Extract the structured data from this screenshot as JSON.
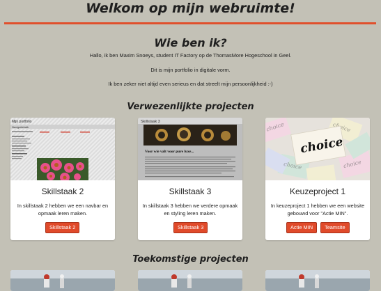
{
  "header": {
    "title": "Welkom op mijn webruimte!"
  },
  "about": {
    "heading": "Wie ben ik?",
    "paragraphs": [
      "Hallo, ik ben Maxim Snoeys, student IT Factory op de ThomasMore Hogeschool in Geel.",
      "Dit is mijn portfolio in digitale vorm.",
      "Ik ben zeker niet altijd even serieus en dat streelt mijn persoonlijkheid :-)"
    ]
  },
  "projects": {
    "heading": "Verwezenlijkte projecten",
    "cards": [
      {
        "title": "Skillstaak 2",
        "text": "In skillstaak 2 hebben we een navbar en opmaak leren maken.",
        "buttons": [
          "Skillstaak 2"
        ],
        "thumb": {
          "page_title": "Mijn portfolio",
          "nav_label": "Navigatiebalk"
        }
      },
      {
        "title": "Skillstaak 3",
        "text": "In skillstaak 3 hebben we verdere opmaak en styling leren maken.",
        "buttons": [
          "Skillstaak 3"
        ],
        "thumb": {
          "page_title": "Skillstaak 3",
          "tagline": "Voor wie valt voor pure luxe..."
        }
      },
      {
        "title": "Keuzeproject 1",
        "text": "In keuzeproject 1 hebben we een website gebouwd voor \"Actie MIN\".",
        "buttons": [
          "Actie MIN",
          "Teamsite"
        ],
        "thumb": {
          "word": "choice"
        }
      }
    ]
  },
  "future": {
    "heading": "Toekomstige projecten"
  },
  "colors": {
    "background": "#c3c1b6",
    "accent": "#e0502c",
    "button": "#e04a2a"
  }
}
